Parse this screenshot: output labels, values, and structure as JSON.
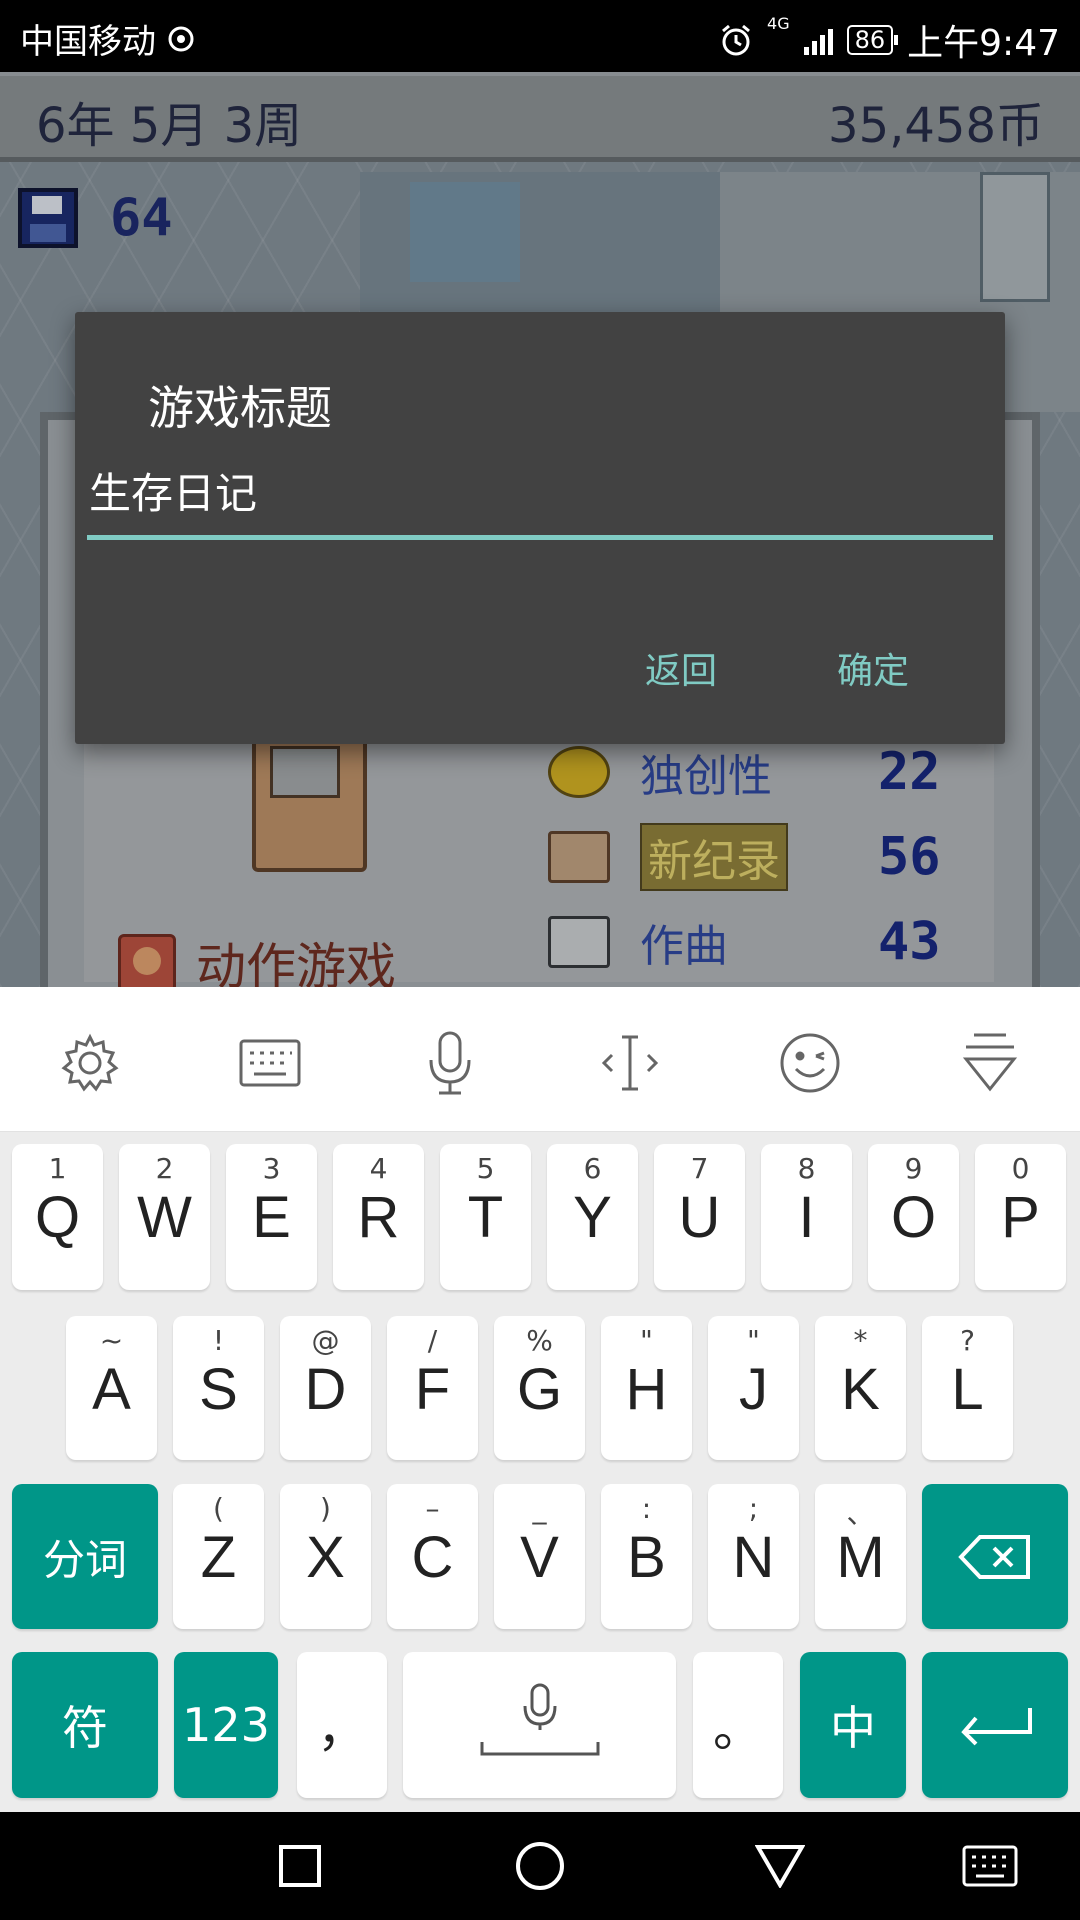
{
  "status_bar": {
    "carrier": "中国移动",
    "network": "4G",
    "battery": "86",
    "time": "上午9:47"
  },
  "game": {
    "date": "6年 5月 3周",
    "coins": "35,458币",
    "save_count": "64",
    "stats": [
      {
        "label": "独创性",
        "value": "22"
      },
      {
        "label": "新纪录",
        "value": "56"
      },
      {
        "label": "作曲",
        "value": "43"
      }
    ],
    "genre": "动作游戏"
  },
  "dialog": {
    "title": "游戏标题",
    "input_value": "生存日记",
    "back_label": "返回",
    "ok_label": "确定"
  },
  "keyboard": {
    "toolbar_icons": [
      "settings-icon",
      "keyboard-icon",
      "microphone-icon",
      "cursor-icon",
      "emoji-icon",
      "collapse-icon"
    ],
    "row1": [
      {
        "main": "Q",
        "sub": "1"
      },
      {
        "main": "W",
        "sub": "2"
      },
      {
        "main": "E",
        "sub": "3"
      },
      {
        "main": "R",
        "sub": "4"
      },
      {
        "main": "T",
        "sub": "5"
      },
      {
        "main": "Y",
        "sub": "6"
      },
      {
        "main": "U",
        "sub": "7"
      },
      {
        "main": "I",
        "sub": "8"
      },
      {
        "main": "O",
        "sub": "9"
      },
      {
        "main": "P",
        "sub": "0"
      }
    ],
    "row2": [
      {
        "main": "A",
        "sub": "~"
      },
      {
        "main": "S",
        "sub": "!"
      },
      {
        "main": "D",
        "sub": "@"
      },
      {
        "main": "F",
        "sub": "/"
      },
      {
        "main": "G",
        "sub": "%"
      },
      {
        "main": "H",
        "sub": "\""
      },
      {
        "main": "J",
        "sub": "\""
      },
      {
        "main": "K",
        "sub": "*"
      },
      {
        "main": "L",
        "sub": "?"
      }
    ],
    "row3": [
      {
        "main": "Z",
        "sub": "("
      },
      {
        "main": "X",
        "sub": ")"
      },
      {
        "main": "C",
        "sub": "–"
      },
      {
        "main": "V",
        "sub": "_"
      },
      {
        "main": "B",
        "sub": ":"
      },
      {
        "main": "N",
        "sub": ";"
      },
      {
        "main": "M",
        "sub": "、"
      }
    ],
    "split_label": "分词",
    "symbol_label": "符",
    "number_label": "123",
    "comma_label": "，",
    "period_label": "。",
    "lang_label": "中"
  },
  "colors": {
    "accent": "#009688",
    "dialog_accent": "#80cbc4",
    "dialog_bg": "#424242"
  }
}
